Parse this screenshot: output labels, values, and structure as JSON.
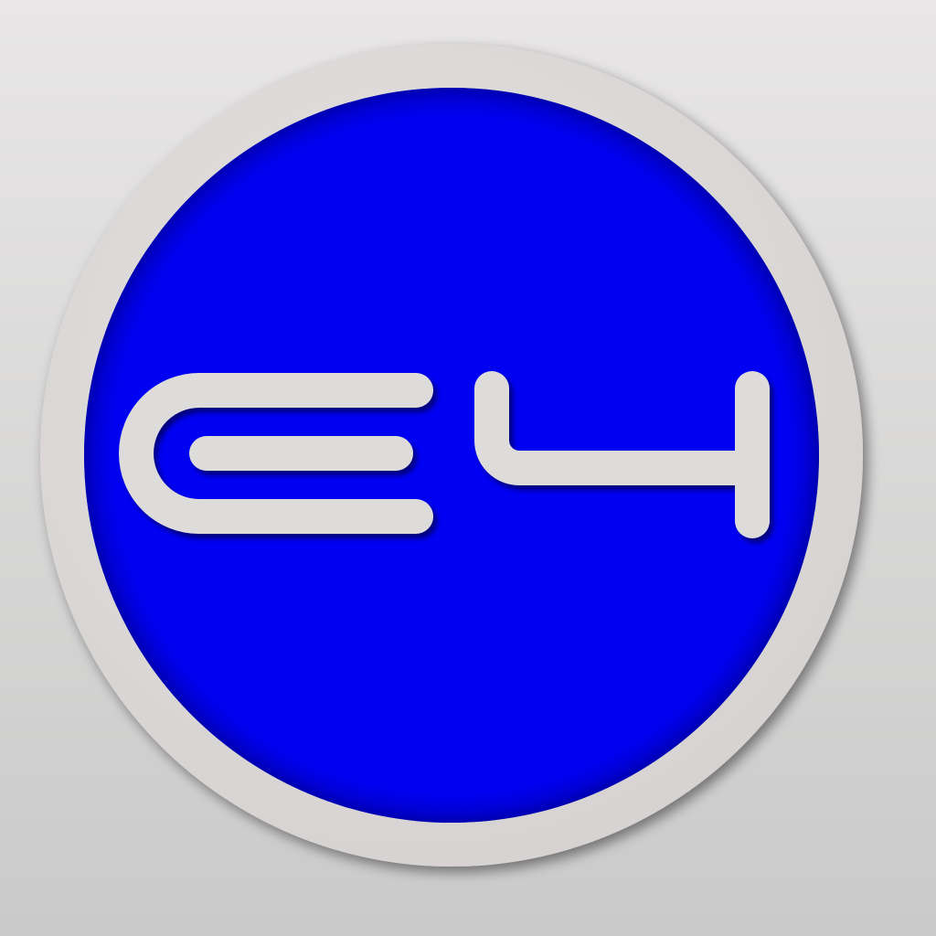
{
  "logo": {
    "text": "E4",
    "icon_name": "e4-logo-icon"
  },
  "colors": {
    "background_top": "#e8e6e6",
    "background_bottom": "#c9cac9",
    "ring": "#dcdad9",
    "disc": "#0000f2",
    "glyph": "#dedcdb"
  }
}
